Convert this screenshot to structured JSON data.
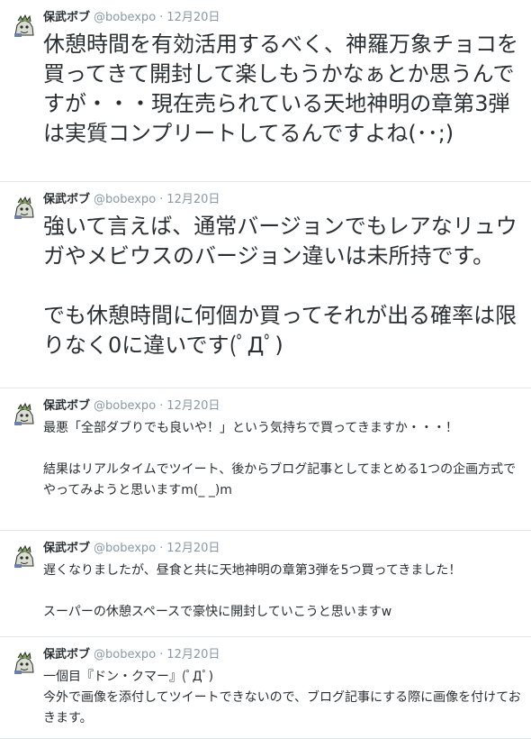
{
  "tweets": [
    {
      "name": "保武ボブ",
      "handle": "@bobexpo",
      "separator": "·",
      "time": "12月20日",
      "text": "休憩時間を有効活用するべく、神羅万象チョコを買ってきて開封して楽しもうかなぁとか思うんですが・・・現在売られている天地神明の章第3弾は実質コンプリートしてるんですよね(･･;)"
    },
    {
      "name": "保武ボブ",
      "handle": "@bobexpo",
      "separator": "·",
      "time": "12月20日",
      "text": "強いて言えば、通常バージョンでもレアなリュウガやメビウスのバージョン違いは未所持です。\n\nでも休憩時間に何個か買ってそれが出る確率は限りなく0に違いです(ﾟДﾟ)"
    },
    {
      "name": "保武ボブ",
      "handle": "@bobexpo",
      "separator": "·",
      "time": "12月20日",
      "text": "最悪「全部ダブりでも良いや！」という気持ちで買ってきますか・・・！\n\n結果はリアルタイムでツイート、後からブログ記事としてまとめる1つの企画方式でやってみようと思いますm(_ _)m"
    },
    {
      "name": "保武ボブ",
      "handle": "@bobexpo",
      "separator": "·",
      "time": "12月20日",
      "text": "遅くなりましたが、昼食と共に天地神明の章第3弾を5つ買ってきました！\n\nスーパーの休憩スペースで豪快に開封していこうと思いますw"
    },
    {
      "name": "保武ボブ",
      "handle": "@bobexpo",
      "separator": "·",
      "time": "12月20日",
      "text": "一個目『ドン・クマー』(ﾟДﾟ)\n今外で画像を添付してツイートできないので、ブログ記事にする際に画像を付けておきます。"
    }
  ]
}
